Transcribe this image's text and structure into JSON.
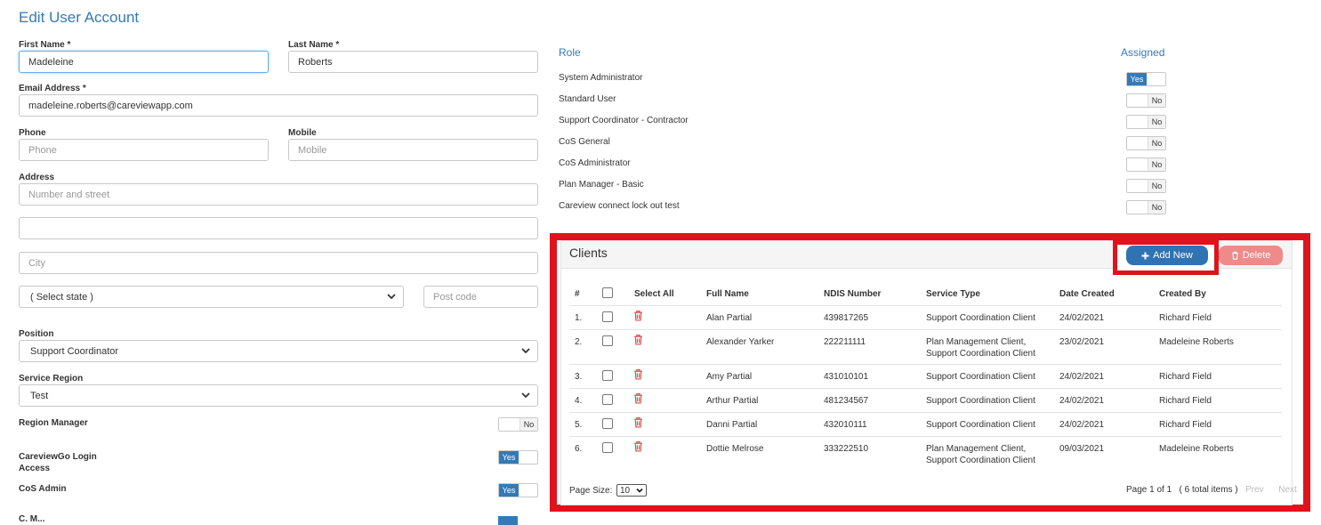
{
  "page": {
    "title": "Edit User Account"
  },
  "form": {
    "first_name_label": "First Name *",
    "first_name_value": "Madeleine",
    "last_name_label": "Last Name *",
    "last_name_value": "Roberts",
    "email_label": "Email Address *",
    "email_value": "madeleine.roberts@careviewapp.com",
    "phone_label": "Phone",
    "phone_placeholder": "Phone",
    "mobile_label": "Mobile",
    "mobile_placeholder": "Mobile",
    "address_label": "Address",
    "address_placeholder": "Number and street",
    "address2_value": "",
    "city_placeholder": "City",
    "state_value": "( Select state )",
    "postcode_placeholder": "Post code",
    "position_label": "Position",
    "position_value": "Support Coordinator",
    "service_region_label": "Service Region",
    "service_region_value": "Test",
    "region_manager_label": "Region Manager",
    "region_manager_state": "No",
    "careviewgo_label_line1": "CareviewGo Login",
    "careviewgo_label_line2": "Access",
    "careviewgo_state": "Yes",
    "cos_admin_label": "CoS Admin",
    "cos_admin_state": "Yes",
    "partial_label": "C. M..."
  },
  "roles": {
    "role_header": "Role",
    "assigned_header": "Assigned",
    "items": [
      {
        "name": "System Administrator",
        "state": "Yes"
      },
      {
        "name": "Standard User",
        "state": "No"
      },
      {
        "name": "Support Coordinator - Contractor",
        "state": "No"
      },
      {
        "name": "CoS General",
        "state": "No"
      },
      {
        "name": "CoS Administrator",
        "state": "No"
      },
      {
        "name": "Plan Manager - Basic",
        "state": "No"
      },
      {
        "name": "Careview connect lock out test",
        "state": "No"
      }
    ]
  },
  "clients": {
    "title": "Clients",
    "add_label": "Add New",
    "delete_label": "Delete",
    "columns": [
      "#",
      "Select All",
      "Full Name",
      "NDIS Number",
      "Service Type",
      "Date Created",
      "Created By"
    ],
    "rows": [
      {
        "num": "1.",
        "name": "Alan Partial",
        "ndis": "439817265",
        "type1": "Support Coordination Client",
        "type2": "",
        "date": "24/02/2021",
        "by": "Richard Field"
      },
      {
        "num": "2.",
        "name": "Alexander Yarker",
        "ndis": "222211111",
        "type1": "Plan Management Client,",
        "type2": "Support Coordination Client",
        "date": "23/02/2021",
        "by": "Madeleine Roberts"
      },
      {
        "num": "3.",
        "name": "Amy Partial",
        "ndis": "431010101",
        "type1": "Support Coordination Client",
        "type2": "",
        "date": "24/02/2021",
        "by": "Richard Field"
      },
      {
        "num": "4.",
        "name": "Arthur Partial",
        "ndis": "481234567",
        "type1": "Support Coordination Client",
        "type2": "",
        "date": "24/02/2021",
        "by": "Richard Field"
      },
      {
        "num": "5.",
        "name": "Danni Partial",
        "ndis": "432010111",
        "type1": "Support Coordination Client",
        "type2": "",
        "date": "24/02/2021",
        "by": "Richard Field"
      },
      {
        "num": "6.",
        "name": "Dottie Melrose",
        "ndis": "333222510",
        "type1": "Plan Management Client,",
        "type2": "Support Coordination Client",
        "date": "09/03/2021",
        "by": "Madeleine Roberts"
      }
    ],
    "page_size_label": "Page Size:",
    "page_size_value": "10",
    "page_info": "Page 1 of 1",
    "total_items": "( 6 total items )",
    "prev_label": "Prev",
    "next_label": "Next"
  },
  "colors": {
    "accent": "#337ab7",
    "highlight": "#e0121b",
    "danger": "#ee8a8a"
  }
}
